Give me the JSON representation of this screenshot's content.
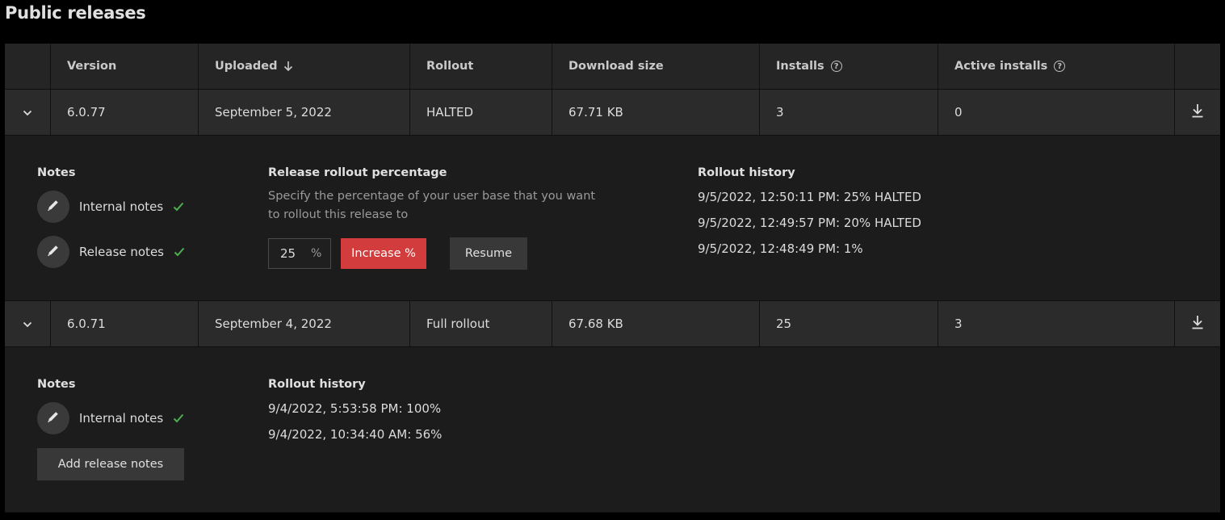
{
  "page": {
    "title": "Public releases"
  },
  "table": {
    "columns": [
      {
        "label": "Version"
      },
      {
        "label": "Uploaded"
      },
      {
        "label": "Rollout"
      },
      {
        "label": "Download size"
      },
      {
        "label": "Installs"
      },
      {
        "label": "Active installs"
      }
    ],
    "rows": [
      {
        "version": "6.0.77",
        "uploaded": "September 5, 2022",
        "rollout": "HALTED",
        "size": "67.71 KB",
        "installs": "3",
        "active_installs": "0",
        "details": {
          "notes_title": "Notes",
          "notes": [
            {
              "label": "Internal notes"
            },
            {
              "label": "Release notes"
            }
          ],
          "rollout_pct_title": "Release rollout percentage",
          "rollout_pct_desc": "Specify the percentage of your user base that you want to rollout this release to",
          "pct_value": "25",
          "pct_sign": "%",
          "increase_label": "Increase %",
          "resume_label": "Resume",
          "history_title": "Rollout history",
          "history": [
            "9/5/2022, 12:50:11 PM: 25% HALTED",
            "9/5/2022, 12:49:57 PM: 20% HALTED",
            "9/5/2022, 12:48:49 PM: 1%"
          ]
        }
      },
      {
        "version": "6.0.71",
        "uploaded": "September 4, 2022",
        "rollout": "Full rollout",
        "size": "67.68 KB",
        "installs": "25",
        "active_installs": "3",
        "details": {
          "notes_title": "Notes",
          "notes": [
            {
              "label": "Internal notes"
            }
          ],
          "add_release_notes_label": "Add release notes",
          "history_title": "Rollout history",
          "history": [
            "9/4/2022, 5:53:58 PM: 100%",
            "9/4/2022, 10:34:40 AM: 56%"
          ]
        }
      }
    ]
  },
  "colors": {
    "accent_red": "#d23c3c",
    "check_green": "#4caf50",
    "background": "#000000"
  }
}
